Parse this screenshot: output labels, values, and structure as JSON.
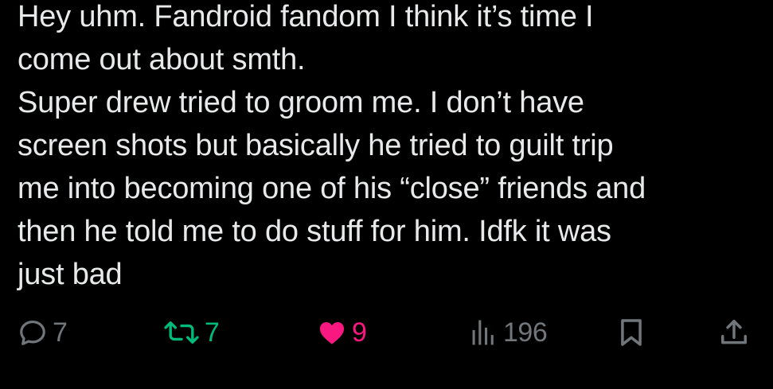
{
  "post": {
    "lines": [
      "Hey uhm. Fandroid fandom I think it’s time I",
      "come out about smth.",
      "Super drew tried to groom me. I don’t have",
      "screen shots but basically he tried to guilt trip",
      "me into becoming one of his “close” friends and",
      "then he told me to do stuff for him. Idfk it was",
      "just bad"
    ]
  },
  "actions": {
    "reply": {
      "icon": "reply-icon",
      "count": "7"
    },
    "repost": {
      "icon": "repost-icon",
      "count": "7",
      "color": "#00ba7c"
    },
    "like": {
      "icon": "heart-icon",
      "count": "9",
      "color": "#f91880"
    },
    "views": {
      "icon": "views-icon",
      "count": "196"
    },
    "bookmark": {
      "icon": "bookmark-icon"
    },
    "share": {
      "icon": "share-icon"
    }
  },
  "colors": {
    "background": "#000000",
    "text": "#e7e9ea",
    "muted": "#71767b"
  }
}
